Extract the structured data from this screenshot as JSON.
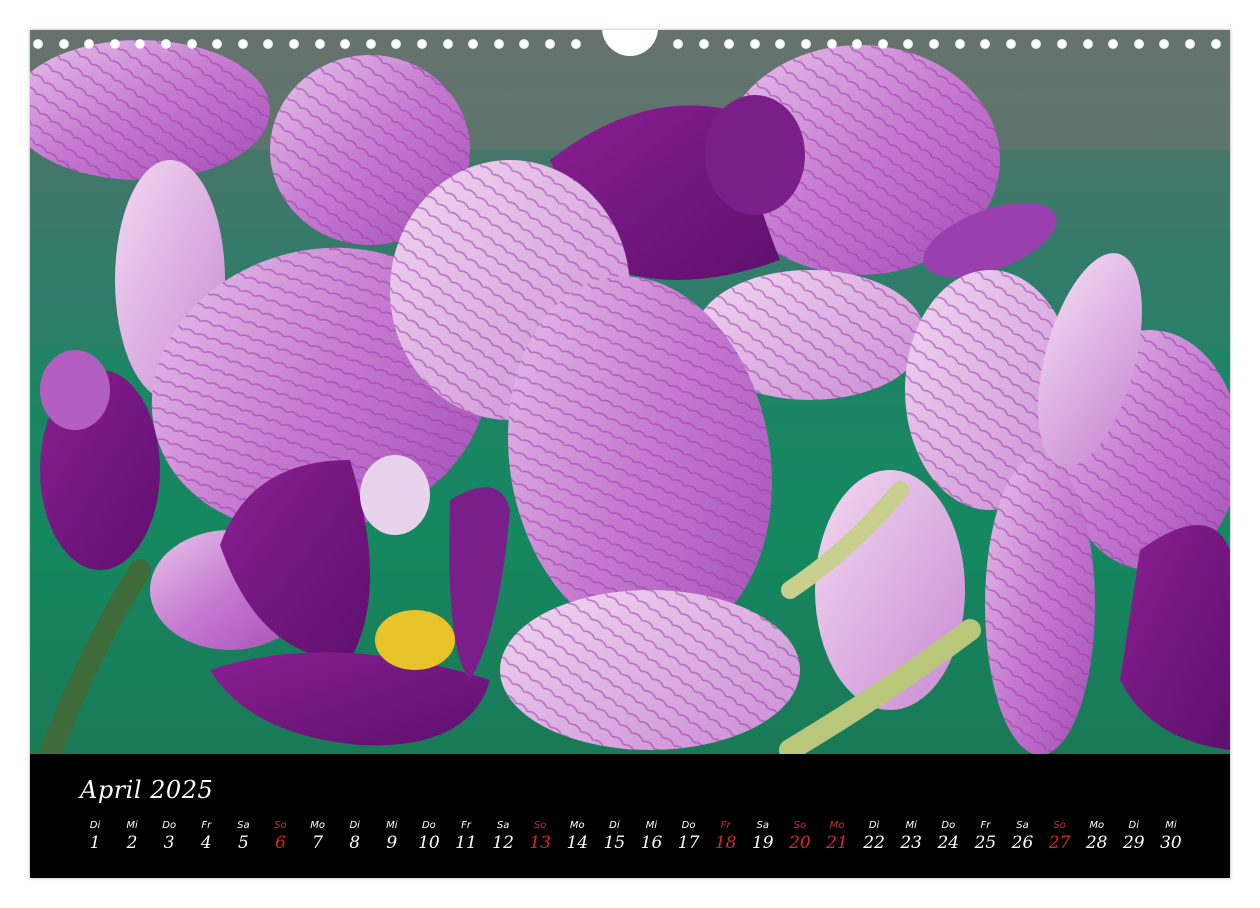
{
  "calendar": {
    "month_title": "April 2025",
    "holiday_color": "#d42a2a",
    "days": [
      {
        "wd": "Di",
        "d": "1",
        "red": false
      },
      {
        "wd": "Mi",
        "d": "2",
        "red": false
      },
      {
        "wd": "Do",
        "d": "3",
        "red": false
      },
      {
        "wd": "Fr",
        "d": "4",
        "red": false
      },
      {
        "wd": "Sa",
        "d": "5",
        "red": false
      },
      {
        "wd": "So",
        "d": "6",
        "red": true
      },
      {
        "wd": "Mo",
        "d": "7",
        "red": false
      },
      {
        "wd": "Di",
        "d": "8",
        "red": false
      },
      {
        "wd": "Mi",
        "d": "9",
        "red": false
      },
      {
        "wd": "Do",
        "d": "10",
        "red": false
      },
      {
        "wd": "Fr",
        "d": "11",
        "red": false
      },
      {
        "wd": "Sa",
        "d": "12",
        "red": false
      },
      {
        "wd": "So",
        "d": "13",
        "red": true
      },
      {
        "wd": "Mo",
        "d": "14",
        "red": false
      },
      {
        "wd": "Di",
        "d": "15",
        "red": false
      },
      {
        "wd": "Mi",
        "d": "16",
        "red": false
      },
      {
        "wd": "Do",
        "d": "17",
        "red": false
      },
      {
        "wd": "Fr",
        "d": "18",
        "red": true
      },
      {
        "wd": "Sa",
        "d": "19",
        "red": false
      },
      {
        "wd": "So",
        "d": "20",
        "red": true
      },
      {
        "wd": "Mo",
        "d": "21",
        "red": true
      },
      {
        "wd": "Di",
        "d": "22",
        "red": false
      },
      {
        "wd": "Mi",
        "d": "23",
        "red": false
      },
      {
        "wd": "Do",
        "d": "24",
        "red": false
      },
      {
        "wd": "Fr",
        "d": "25",
        "red": false
      },
      {
        "wd": "Sa",
        "d": "26",
        "red": false
      },
      {
        "wd": "So",
        "d": "27",
        "red": true
      },
      {
        "wd": "Mo",
        "d": "28",
        "red": false
      },
      {
        "wd": "Di",
        "d": "29",
        "red": false
      },
      {
        "wd": "Mi",
        "d": "30",
        "red": false
      }
    ]
  }
}
